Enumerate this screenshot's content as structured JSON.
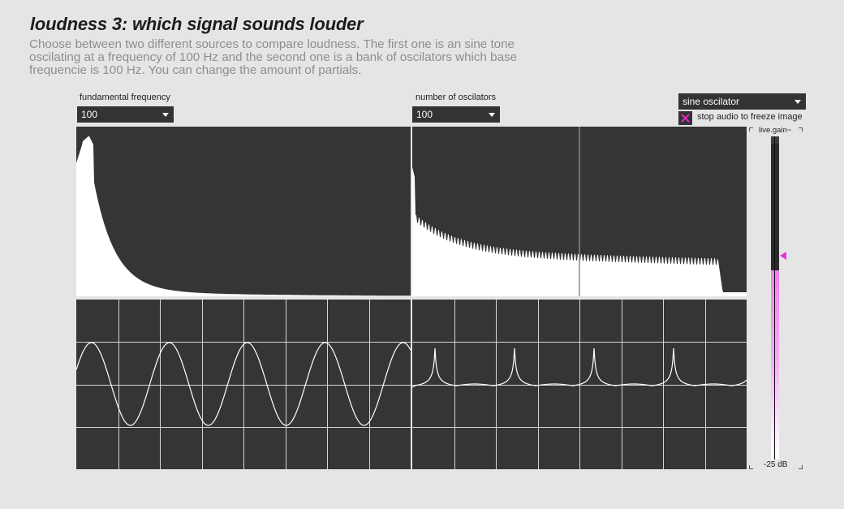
{
  "header": {
    "title": "loudness 3: which signal sounds louder",
    "description": "Choose between two different sources to compare loudness. The first one is an sine tone oscilating at a frequency of 100 Hz and the second one is a bank of oscilators which base frequencie is 100 Hz. You can change the amount of partials."
  },
  "controls": {
    "fundamental": {
      "label": "fundamental frequency",
      "value": "100"
    },
    "oscillators": {
      "label": "number of oscilators",
      "value": "100"
    },
    "source": {
      "value": "sine oscilator"
    },
    "freeze": {
      "label": "stop audio to freeze image",
      "checked": true
    }
  },
  "meter": {
    "name": "live.gain~",
    "value_label": "-25 dB",
    "level": 0.6,
    "slider_level": 0.63,
    "accent": "#f07ef0",
    "handle_color": "#e830e0"
  },
  "colors": {
    "panel": "#353535",
    "grid": "#cfcfcf",
    "trace": "#ffffff"
  }
}
